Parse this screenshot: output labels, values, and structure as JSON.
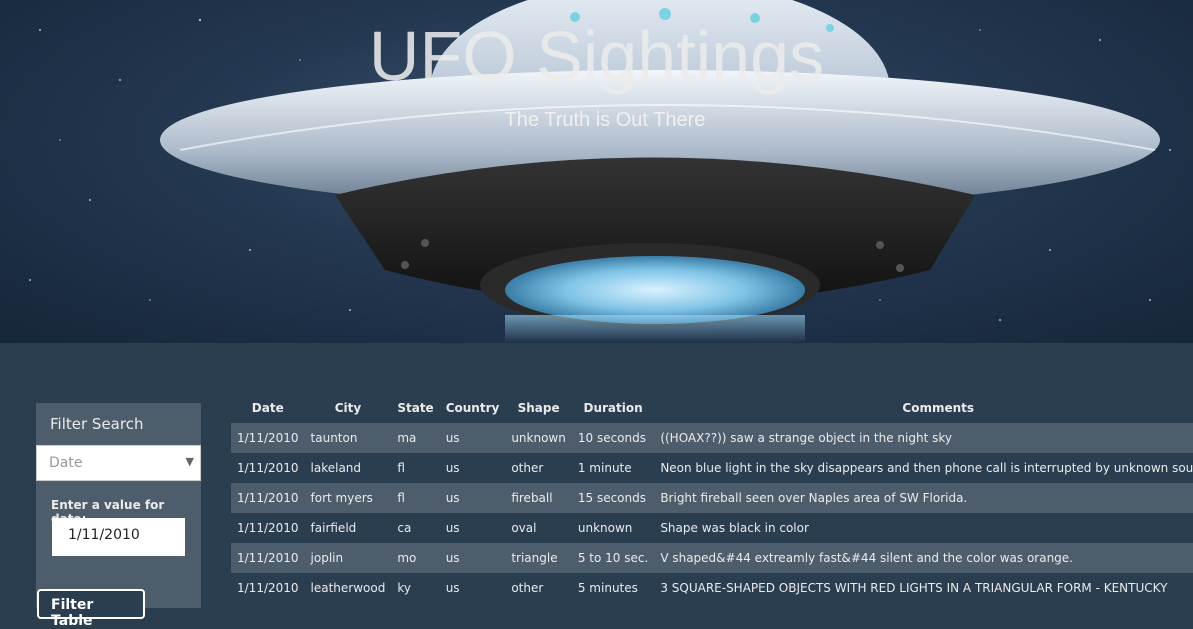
{
  "hero": {
    "title": "UFO Sightings",
    "subtitle": "The Truth is Out There"
  },
  "filter": {
    "heading": "Filter Search",
    "select_value": "Date",
    "label": "Enter a value for date:",
    "input_value": "1/11/2010",
    "button_label": "Filter Table"
  },
  "table": {
    "headers": [
      "Date",
      "City",
      "State",
      "Country",
      "Shape",
      "Duration",
      "Comments"
    ],
    "rows": [
      [
        "1/11/2010",
        "taunton",
        "ma",
        "us",
        "unknown",
        "10 seconds",
        "((HOAX??)) saw a strange object in the night sky"
      ],
      [
        "1/11/2010",
        "lakeland",
        "fl",
        "us",
        "other",
        "1 minute",
        "Neon blue light in the sky disappears and then phone call is interrupted by unknown sound ."
      ],
      [
        "1/11/2010",
        "fort myers",
        "fl",
        "us",
        "fireball",
        "15 seconds",
        "Bright fireball seen over Naples area of SW Florida."
      ],
      [
        "1/11/2010",
        "fairfield",
        "ca",
        "us",
        "oval",
        "unknown",
        "Shape was black in color"
      ],
      [
        "1/11/2010",
        "joplin",
        "mo",
        "us",
        "triangle",
        "5 to 10 sec.",
        "V shaped&#44 extreamly fast&#44 silent and the color was orange."
      ],
      [
        "1/11/2010",
        "leatherwood",
        "ky",
        "us",
        "other",
        "5 minutes",
        "3 SQUARE-SHAPED OBJECTS WITH RED LIGHTS IN A TRIANGULAR FORM - KENTUCKY"
      ]
    ]
  },
  "colors": {
    "page_bg": "#2b3e50",
    "panel_bg": "#4e5d6c",
    "stripe_row": "#4e5d6c"
  }
}
